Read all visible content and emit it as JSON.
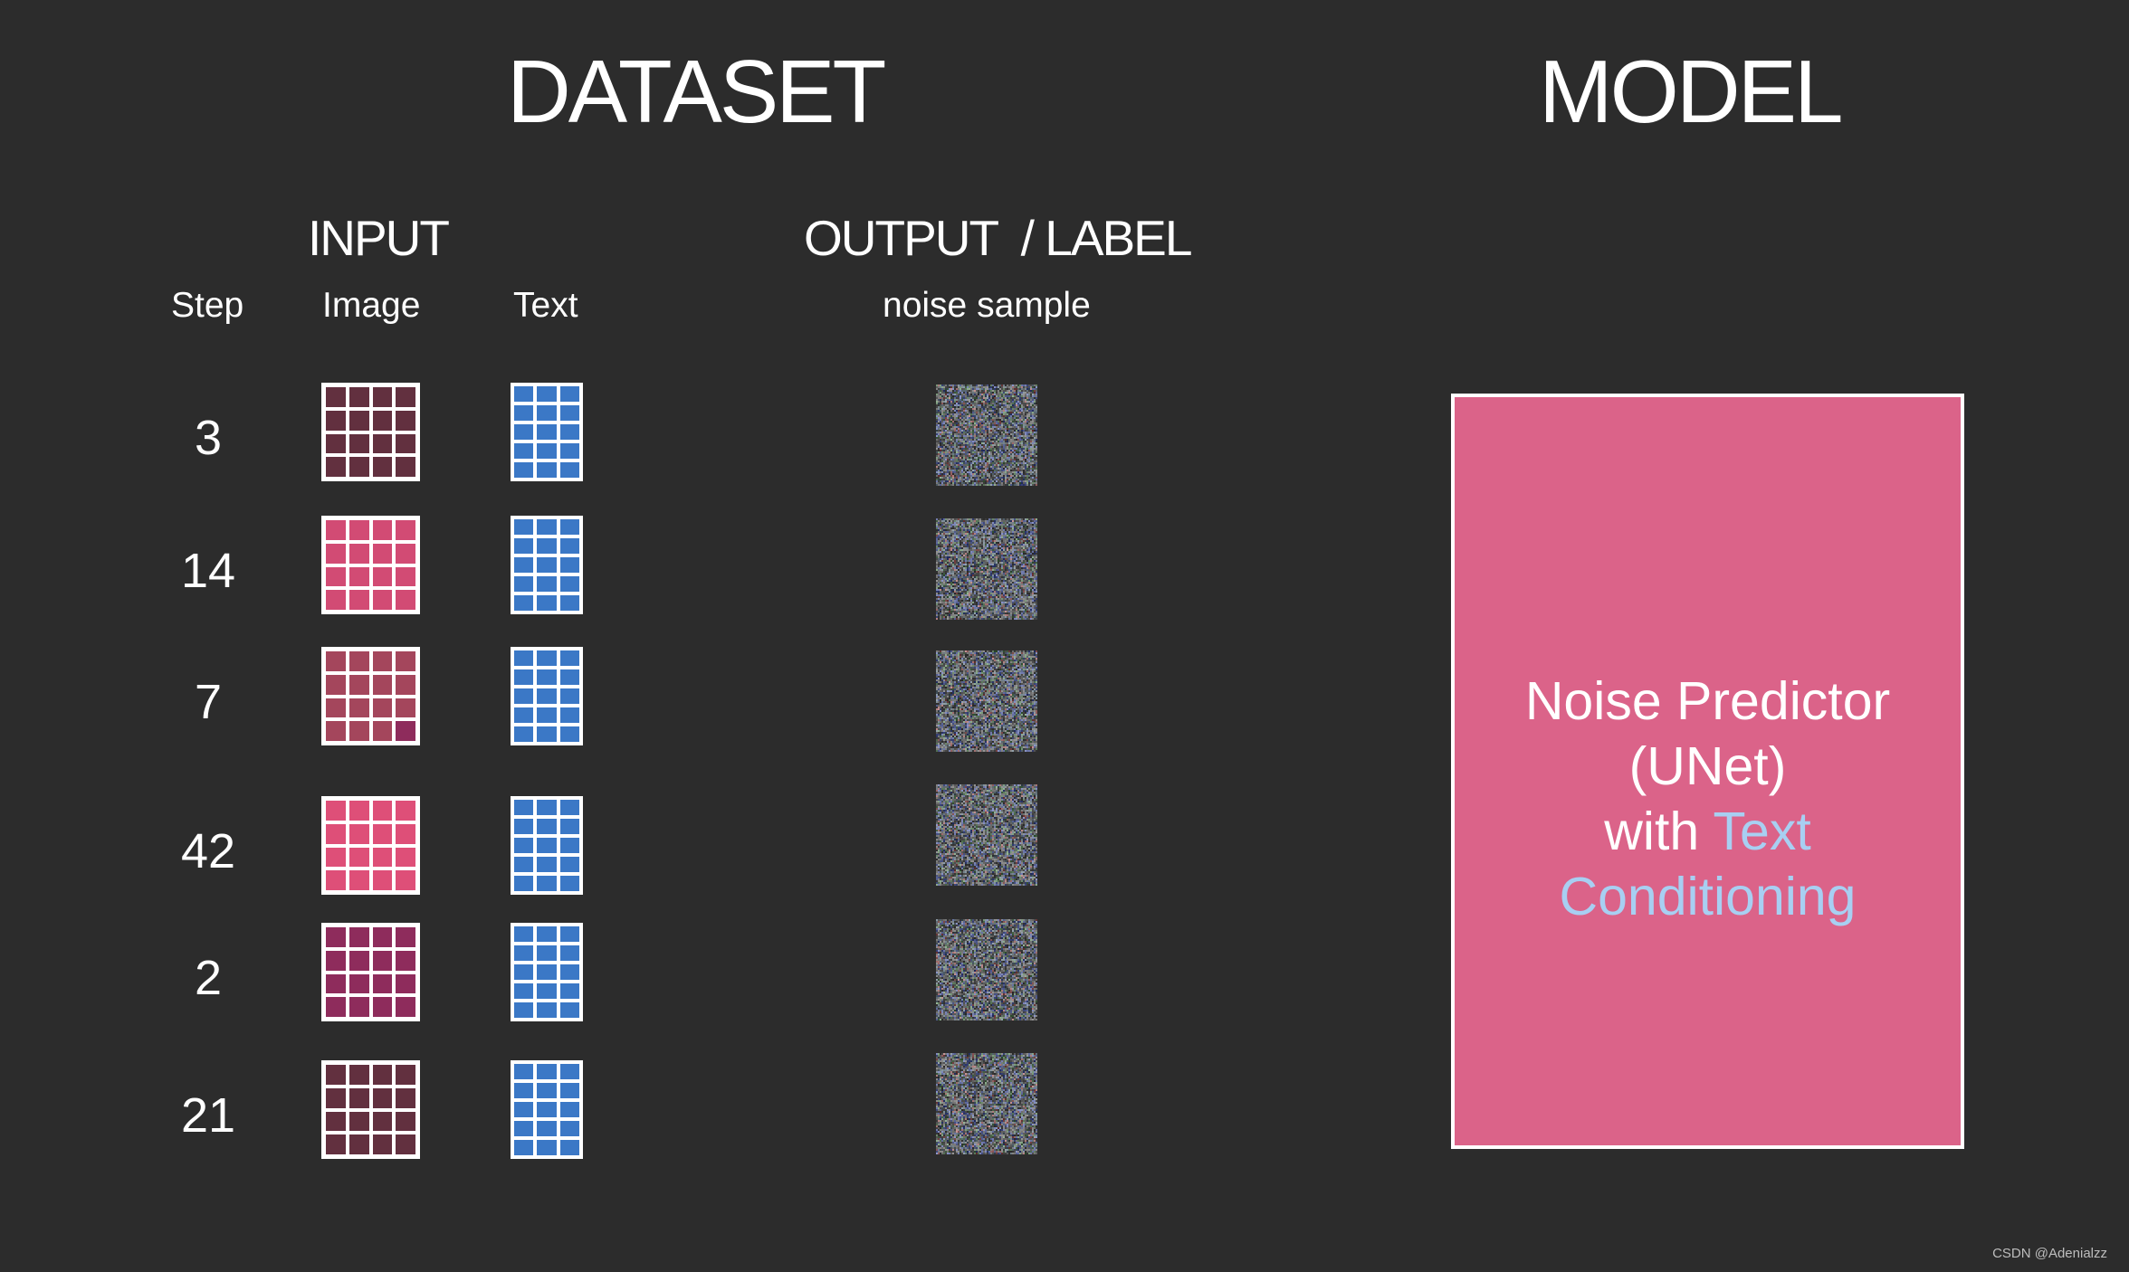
{
  "headers": {
    "dataset": "DATASET",
    "model": "MODEL",
    "input": "INPUT",
    "output_label": "OUTPUT  / LABEL"
  },
  "columns": {
    "step": "Step",
    "image": "Image",
    "text": "Text",
    "noise_sample": "noise sample"
  },
  "rows": [
    {
      "step": "3",
      "image_color": "#62303f",
      "image_accent_color": null
    },
    {
      "step": "14",
      "image_color": "#d24b74",
      "image_accent_color": null
    },
    {
      "step": "7",
      "image_color": "#a4465c",
      "image_accent_color": "#8e2c5c"
    },
    {
      "step": "42",
      "image_color": "#de4f78",
      "image_accent_color": null
    },
    {
      "step": "2",
      "image_color": "#8e2c5c",
      "image_accent_color": null
    },
    {
      "step": "21",
      "image_color": "#62303f",
      "image_accent_color": null
    }
  ],
  "text_embedding_color": "#3b78c6",
  "model": {
    "line1": "Noise Predictor",
    "line2": "(UNet)",
    "line3_prefix": "with ",
    "line3_highlight": "Text",
    "line4_highlight": "Conditioning",
    "box_color": "#db6389",
    "highlight_color": "#a8cff2"
  },
  "watermark": "CSDN @Adenialzz"
}
